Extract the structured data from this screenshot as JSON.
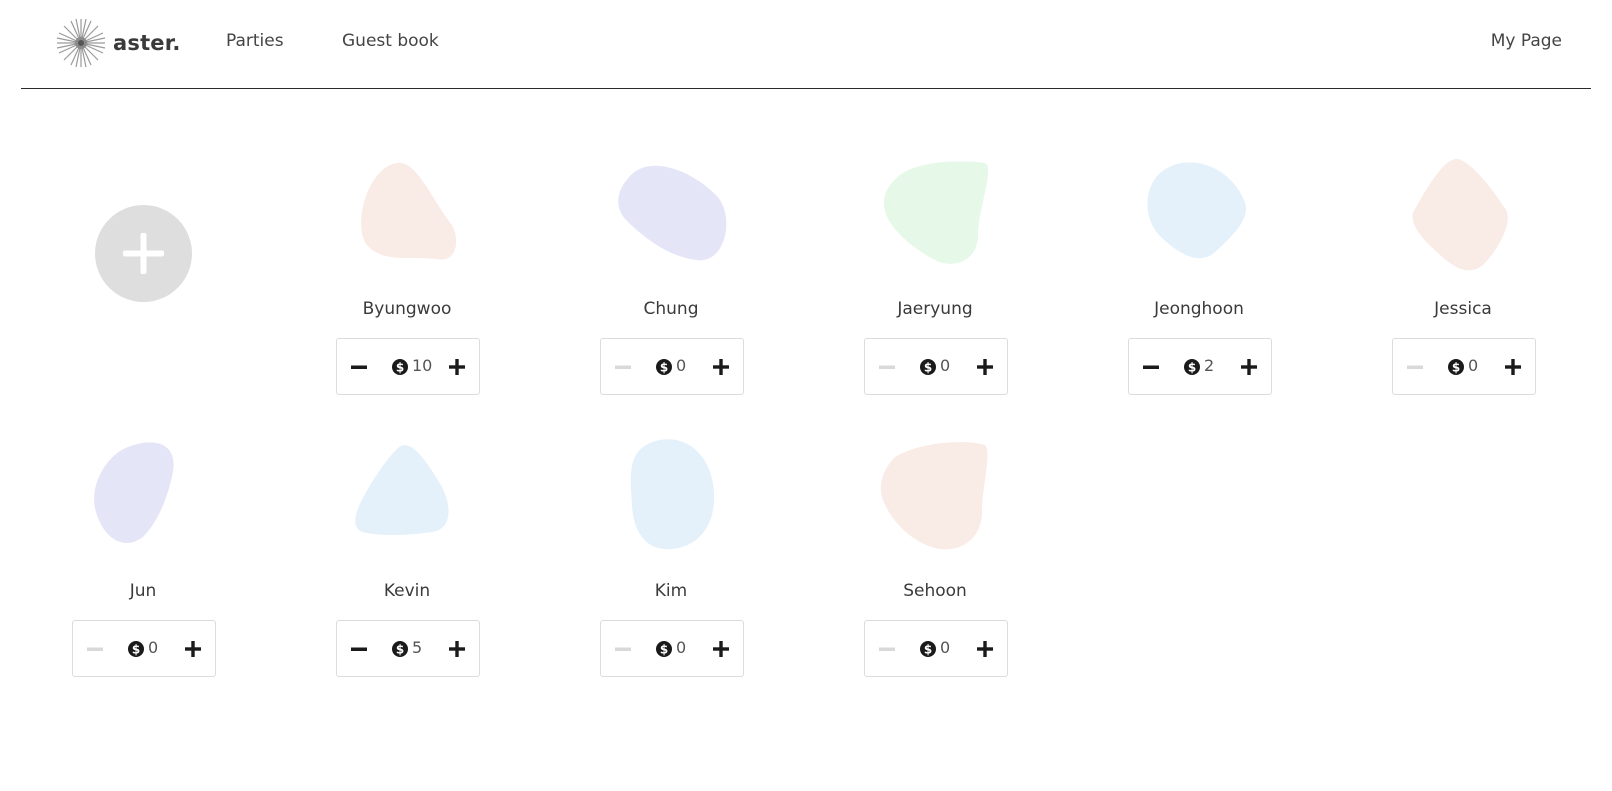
{
  "nav": {
    "brand": "aster.",
    "links": [
      "Parties",
      "Guest book"
    ],
    "my_page": "My Page"
  },
  "add_button_icon": "plus-icon",
  "guests": [
    {
      "name": "Byungwoo",
      "count": "10",
      "color": "#f9ebe5",
      "minus_enabled": true
    },
    {
      "name": "Chung",
      "count": "0",
      "color": "#e5e5f8",
      "minus_enabled": false
    },
    {
      "name": "Jaeryung",
      "count": "0",
      "color": "#e6f8e7",
      "minus_enabled": false
    },
    {
      "name": "Jeonghoon",
      "count": "2",
      "color": "#e5f1fa",
      "minus_enabled": true
    },
    {
      "name": "Jessica",
      "count": "0",
      "color": "#f9ebe5",
      "minus_enabled": false
    },
    {
      "name": "Jun",
      "count": "0",
      "color": "#e5e5f8",
      "minus_enabled": false
    },
    {
      "name": "Kevin",
      "count": "5",
      "color": "#e5f1fa",
      "minus_enabled": true
    },
    {
      "name": "Kim",
      "count": "0",
      "color": "#e5f1fa",
      "minus_enabled": false
    },
    {
      "name": "Sehoon",
      "count": "0",
      "color": "#f9ebe5",
      "minus_enabled": false
    }
  ],
  "icons": {
    "coin": "dollar-coin-icon",
    "minus": "minus-icon",
    "plus": "plus-icon"
  }
}
